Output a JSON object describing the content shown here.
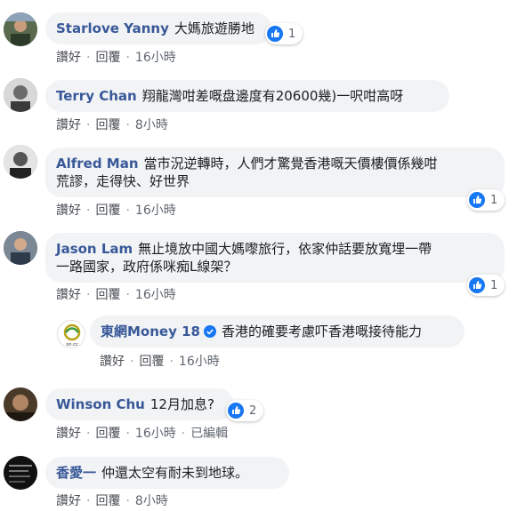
{
  "actions": {
    "like": "讚好",
    "reply": "回覆",
    "sep": "·",
    "edited": "已編輯"
  },
  "comments": [
    {
      "author": "Starlove Yanny",
      "text": "大媽旅遊勝地",
      "time": "16小時",
      "likes": "1"
    },
    {
      "author": "Terry Chan",
      "text": "翔龍灣咁差嘅盘邊度有20600幾)一呎咁高呀",
      "time": "8小時"
    },
    {
      "author": "Alfred Man",
      "text_line1": "當市況逆轉時，人們才驚覺香港嘅天價樓價係幾咁",
      "text_line2": "荒謬，走得快、好世界",
      "time": "16小時",
      "likes": "1"
    },
    {
      "author": "Jason Lam",
      "text_line1": "無止境放中國大媽嚟旅行，依家仲話要放寬埋一帶",
      "text_line2": "一路國家，政府係咪痴L線架？",
      "time": "16小時",
      "likes": "1",
      "reply": {
        "author": "東網Money 18",
        "text": "香港的確要考慮吓香港嘅接待能力",
        "time": "16小時",
        "avatar_label": "on.cc"
      }
    },
    {
      "author": "Winson Chu",
      "text": "12月加息?",
      "time": "16小時",
      "likes": "2"
    },
    {
      "author": "香愛一",
      "text": "仲還太空有耐未到地球。",
      "time": "8小時"
    }
  ],
  "colors": {
    "author": "#385898",
    "bubble": "#f2f3f5",
    "like_blue": "#1877f2",
    "verified": "#1877f2"
  }
}
